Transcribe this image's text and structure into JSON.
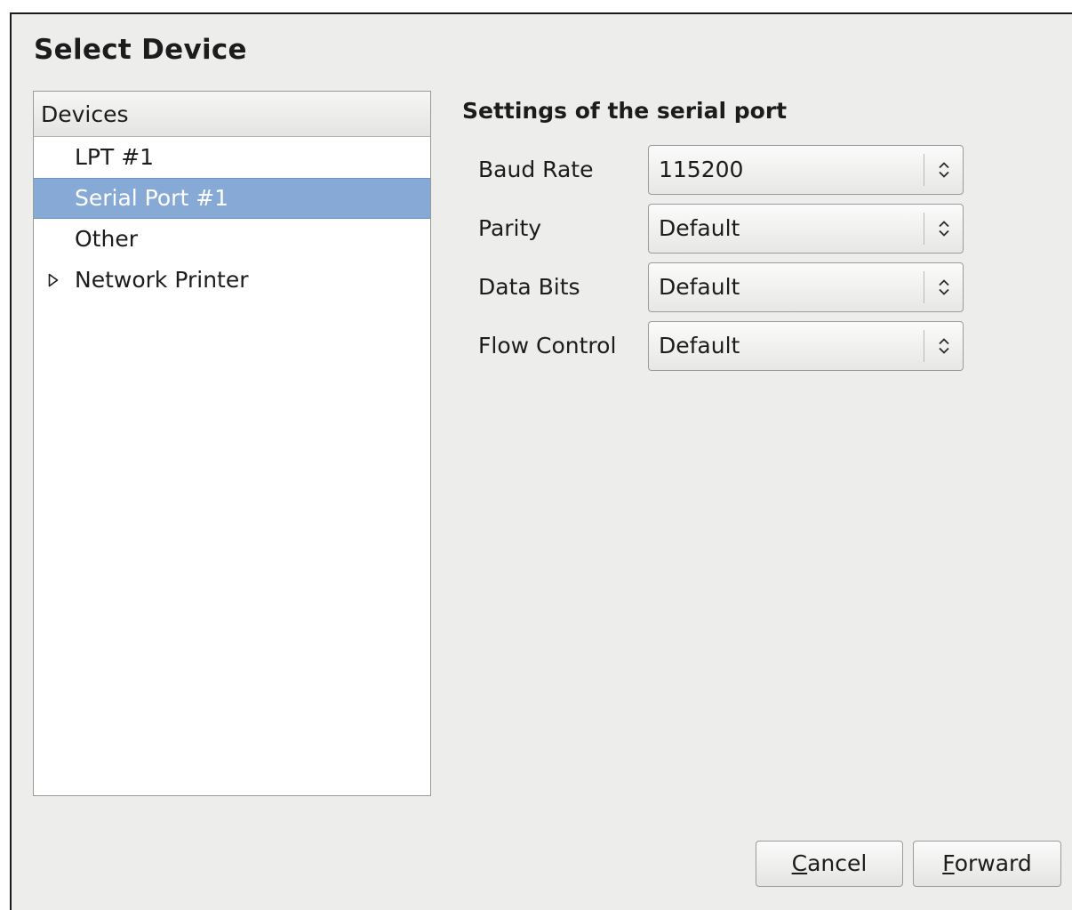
{
  "dialog": {
    "title": "Select Device"
  },
  "device_list": {
    "header": "Devices",
    "items": [
      {
        "label": "LPT #1",
        "selected": false,
        "expandable": false
      },
      {
        "label": "Serial Port #1",
        "selected": true,
        "expandable": false
      },
      {
        "label": "Other",
        "selected": false,
        "expandable": false
      },
      {
        "label": "Network Printer",
        "selected": false,
        "expandable": true
      }
    ],
    "selection_color": "#86a9d6"
  },
  "settings": {
    "title": "Settings of the serial port",
    "fields": [
      {
        "label": "Baud Rate",
        "value": "115200",
        "icon": "updown-arrows-icon"
      },
      {
        "label": "Parity",
        "value": "Default",
        "icon": "updown-arrows-icon"
      },
      {
        "label": "Data Bits",
        "value": "Default",
        "icon": "updown-arrows-icon"
      },
      {
        "label": "Flow Control",
        "value": "Default",
        "icon": "updown-arrows-icon"
      }
    ]
  },
  "buttons": {
    "cancel": {
      "mnemonic": "C",
      "rest": "ancel"
    },
    "forward": {
      "mnemonic": "F",
      "rest": "orward"
    }
  }
}
